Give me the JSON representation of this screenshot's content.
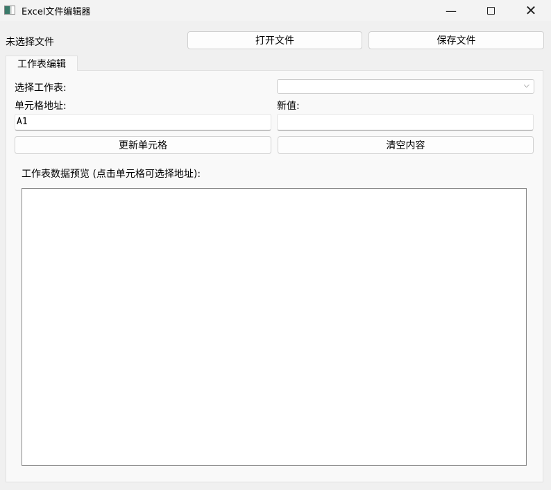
{
  "window": {
    "title": "Excel文件编辑器"
  },
  "top": {
    "file_status": "未选择文件",
    "open_button": "打开文件",
    "save_button": "保存文件"
  },
  "tabs": [
    {
      "label": "工作表编辑"
    }
  ],
  "editor": {
    "sheet_label": "选择工作表:",
    "sheet_value": "",
    "cell_label": "单元格地址:",
    "cell_value": "A1",
    "value_label": "新值:",
    "value_value": "",
    "update_button": "更新单元格",
    "clear_button": "清空内容",
    "preview_label": "工作表数据预览 (点击单元格可选择地址):"
  }
}
